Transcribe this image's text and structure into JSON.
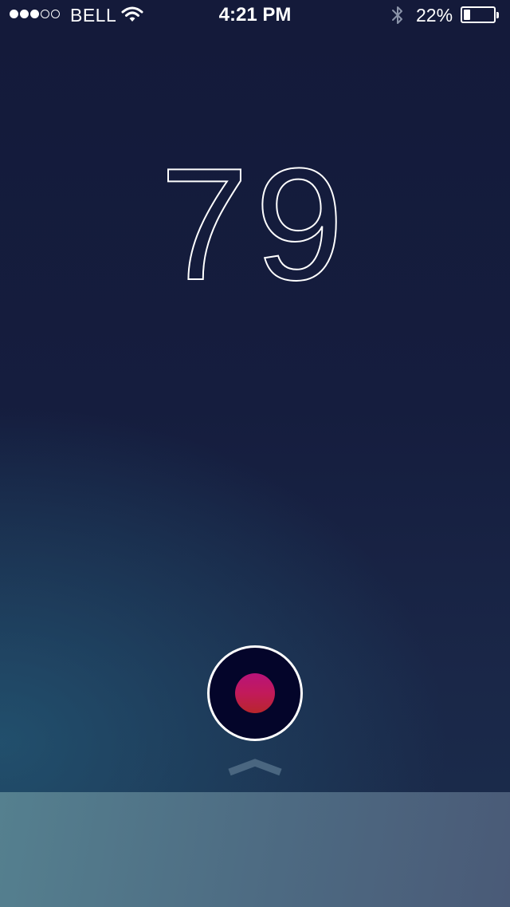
{
  "status_bar": {
    "signal_bars_filled": 3,
    "signal_bars_total": 5,
    "carrier": "BELL",
    "wifi_icon": "wifi-icon",
    "time": "4:21 PM",
    "bluetooth_icon": "bluetooth-icon",
    "battery_percent": "22%",
    "battery_level": 0.22
  },
  "main": {
    "value": "79"
  },
  "controls": {
    "record_icon": "record-icon",
    "chevron_icon": "chevron-up-icon"
  },
  "colors": {
    "background_top": "#141a3a",
    "background_bottom": "#1b2d4c",
    "record_dot_top": "#b8137a",
    "record_dot_bottom": "#b8262c",
    "panel": "#4d6a82"
  }
}
